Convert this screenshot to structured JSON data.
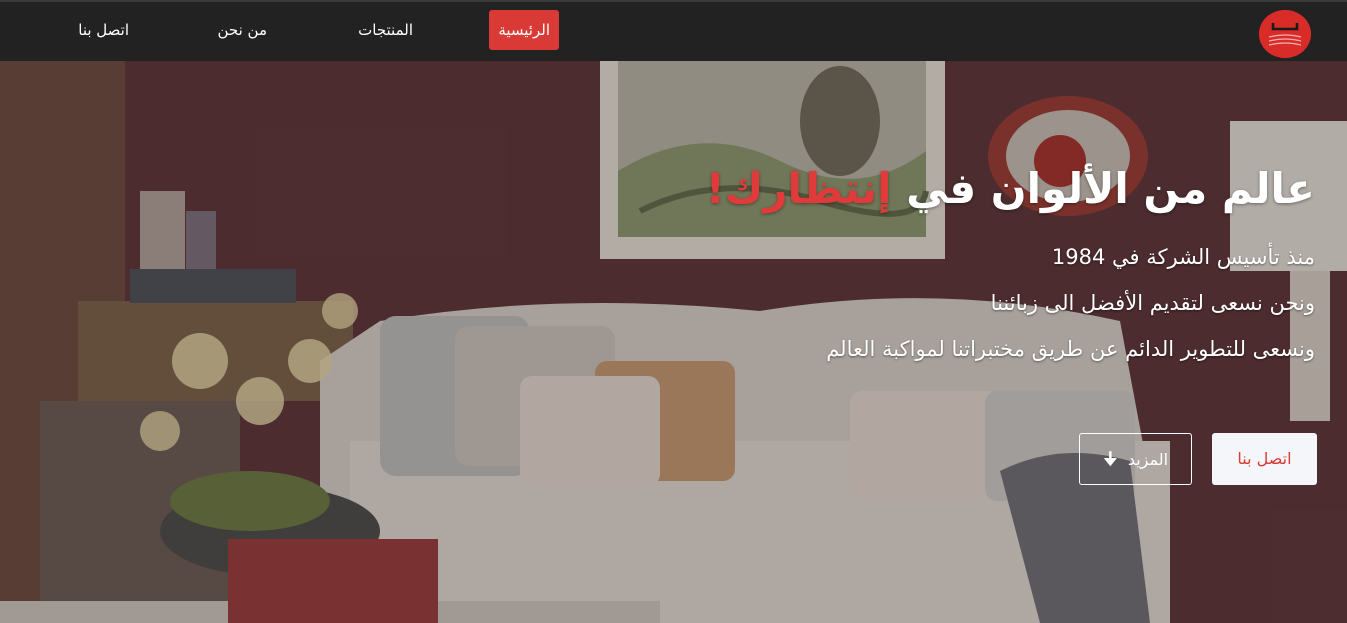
{
  "nav": {
    "logo_name": "brand-logo",
    "items": [
      {
        "label": "الرئيسية",
        "active": true
      },
      {
        "label": "المنتجات",
        "active": false
      },
      {
        "label": "من نحن",
        "active": false
      },
      {
        "label": "اتصل بنا",
        "active": false
      }
    ]
  },
  "hero": {
    "title_main": "عالم من الألوان في ",
    "title_accent": "إنتظارك!",
    "lines": [
      "منذ تأسيس الشركة في 1984",
      "ونحن نسعى لتقديم الأفضل الى زبائننا",
      "ونسعى للتطوير الدائم عن طريق مختبراتنا لمواكبة العالم"
    ],
    "buttons": {
      "contact": "اتصل بنا",
      "more": "المزيد",
      "more_icon": "arrow-down-icon"
    }
  },
  "colors": {
    "accent": "#d93a35",
    "navbar": "#222222",
    "button_light": "#f5f6fa"
  }
}
